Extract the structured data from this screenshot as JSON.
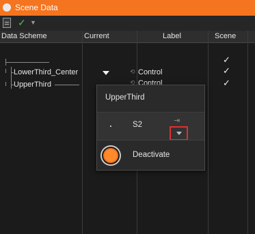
{
  "window": {
    "title": "Scene Data"
  },
  "toolbar": {
    "doc_icon": "document-icon",
    "confirm_icon": "checkmark-icon",
    "dropdown_icon": "caret-down-icon"
  },
  "columns": [
    "Data Scheme",
    "Current",
    "Label",
    "Scene"
  ],
  "rows": [
    {
      "name": "LowerThird_Center",
      "label": "Control",
      "scene": "✓"
    },
    {
      "name": "UpperThird",
      "label": "Control",
      "scene": "✓"
    }
  ],
  "top_scene_check": "✓",
  "popup": {
    "title": "UpperThird",
    "selected_value": "S2",
    "action_label": "Deactivate",
    "accent_color": "#f4741f"
  },
  "colors": {
    "titlebar": "#f4741f",
    "check": "#4ec24e",
    "highlight_border": "#e0302e"
  }
}
